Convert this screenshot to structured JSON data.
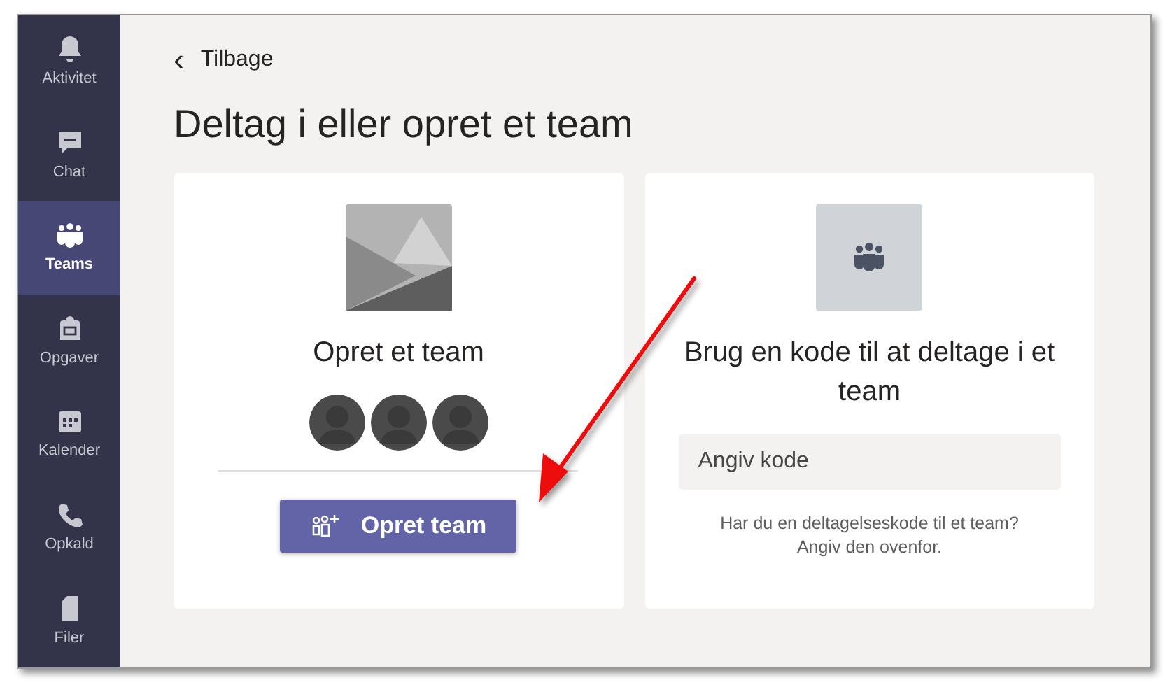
{
  "sidebar": {
    "items": [
      {
        "label": "Aktivitet",
        "selected": false
      },
      {
        "label": "Chat",
        "selected": false
      },
      {
        "label": "Teams",
        "selected": true
      },
      {
        "label": "Opgaver",
        "selected": false
      },
      {
        "label": "Kalender",
        "selected": false
      },
      {
        "label": "Opkald",
        "selected": false
      },
      {
        "label": "Filer",
        "selected": false
      }
    ]
  },
  "back_link": {
    "icon": "‹",
    "label": "Tilbage"
  },
  "title": "Deltag i eller opret et team",
  "create_card": {
    "heading": "Opret et team",
    "button": "Opret team"
  },
  "join_card": {
    "heading": "Brug en kode til at deltage i et team",
    "placeholder": "Angiv kode",
    "hint": "Har du en deltagelseskode til et team? Angiv den ovenfor."
  }
}
